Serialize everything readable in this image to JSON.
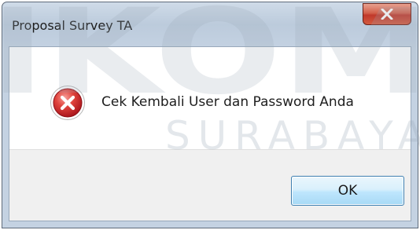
{
  "window": {
    "title": "Proposal Survey TA",
    "close_icon": "close-icon"
  },
  "dialog": {
    "icon": "error-icon",
    "message": "Cek Kembali User dan Password Anda",
    "ok_label": "OK"
  },
  "watermark": {
    "top_text": "IKOM",
    "bottom_text": "SURABAYA"
  },
  "colors": {
    "close_button": "#c0392b",
    "error_icon": "#c8272b",
    "ok_button_border": "#3c7fb1"
  }
}
